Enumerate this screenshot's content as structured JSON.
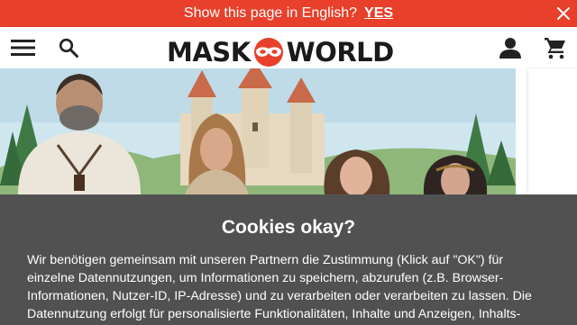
{
  "language_banner": {
    "question": "Show this page in English?",
    "yes_label": "YES",
    "background": "#e8402b"
  },
  "header": {
    "logo_text_left": "MASK",
    "logo_text_right": "WORLD",
    "menu_icon": "hamburger-menu-icon",
    "search_icon": "search-icon",
    "account_icon": "user-icon",
    "cart_icon": "shopping-cart-icon",
    "accent": "#e8402b"
  },
  "cookie_notice": {
    "title": "Cookies okay?",
    "body": "Wir benötigen gemeinsam mit unseren Partnern die Zustimmung (Klick auf \"OK\") für einzelne Datennutzungen, um Informationen zu speichern, abzurufen (z.B. Browser-Informationen, Nutzer-ID, IP-Adresse) und zu verarbeiten oder verarbeiten zu lassen. Die Datennutzung erfolgt für personalisierte Funktionalitäten, Inhalte und Anzeigen, Inhalts-"
  }
}
